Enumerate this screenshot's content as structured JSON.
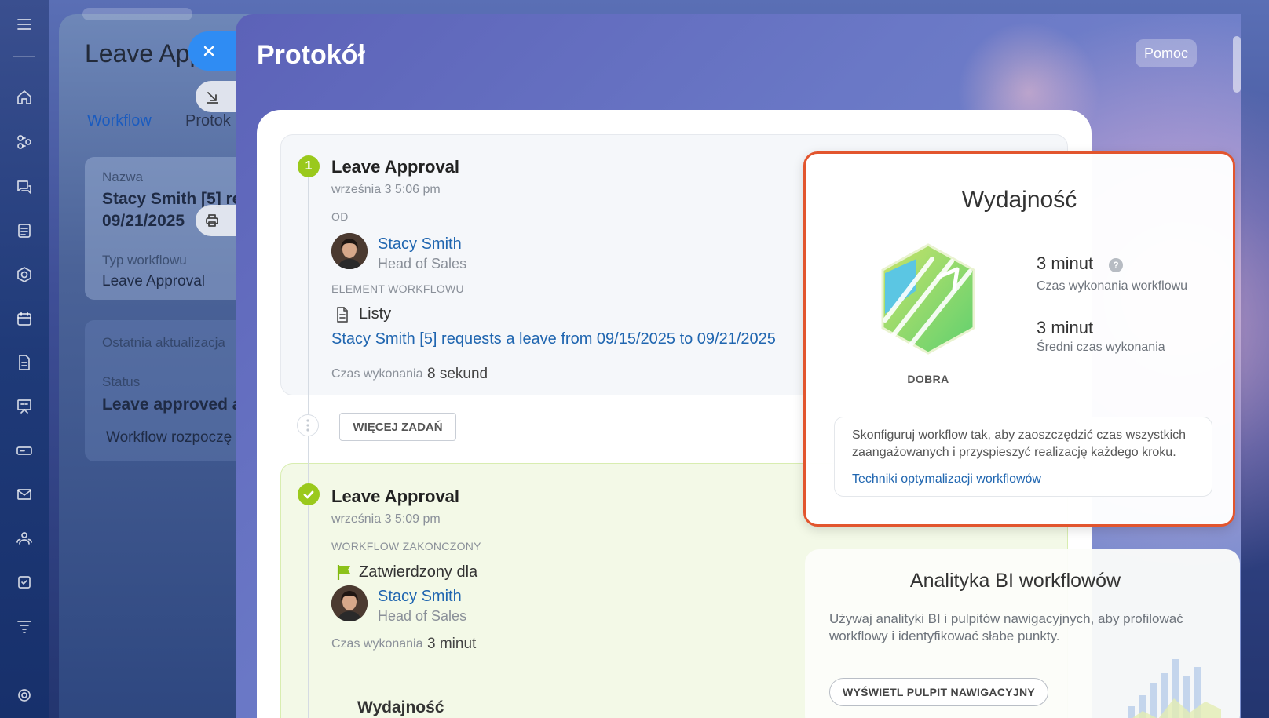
{
  "background_page": {
    "title": "Leave Appr",
    "tabs": {
      "workflow": "Workflow",
      "protocol": "Protok"
    },
    "fields": {
      "name_label": "Nazwa",
      "name_value_line1": "Stacy Smith [5] re",
      "name_value_line2": "09/21/2025",
      "type_label": "Typ workflowu",
      "type_value": "Leave Approval",
      "updated_label": "Ostatnia aktualizacja",
      "status_label": "Status",
      "status_value": "Leave approved a",
      "started_text": "Workflow rozpoczę"
    }
  },
  "slider": {
    "title": "Protokół",
    "help_label": "Pomoc"
  },
  "step1": {
    "number": "1",
    "title": "Leave Approval",
    "date": "września 3 5:06 pm",
    "from_caption": "OD",
    "user_name": "Stacy Smith",
    "user_role": "Head of Sales",
    "element_caption": "ELEMENT WORKFLOWU",
    "element_name": "Listy",
    "element_link": "Stacy Smith [5] requests a leave from 09/15/2025 to 09/21/2025",
    "exec_label": "Czas wykonania",
    "exec_value": "8 sekund"
  },
  "more_tasks_label": "WIĘCEJ ZADAŃ",
  "step2": {
    "title": "Leave Approval",
    "date": "września 3 5:09 pm",
    "done_caption": "WORKFLOW ZAKOŃCZONY",
    "approved_text": "Zatwierdzony dla",
    "user_name": "Stacy Smith",
    "user_role": "Head of Sales",
    "exec_label": "Czas wykonania",
    "exec_value": "3 minut",
    "sub_title": "Wydajność"
  },
  "performance": {
    "title": "Wydajność",
    "grade": "DOBRA",
    "metric1_value": "3 minut",
    "metric1_label": "Czas wykonania workflowu",
    "metric2_value": "3 minut",
    "metric2_label": "Średni czas wykonania",
    "tip_text": "Skonfiguruj workflow tak, aby zaoszczędzić czas wszystkich zaangażowanych i przyspieszyć realizację każdego kroku.",
    "tip_link": "Techniki optymalizacji workflowów",
    "highlight_color": "#e2552e"
  },
  "bi": {
    "title": "Analityka BI workflowów",
    "text": "Używaj analityki BI i pulpitów nawigacyjnych, aby profilować workflowy i identyfikować słabe punkty.",
    "button": "WYŚWIETL PULPIT NAWIGACYJNY"
  },
  "colors": {
    "accent": "#2f8cf3",
    "success": "#9ac91c",
    "link": "#2066b0"
  }
}
